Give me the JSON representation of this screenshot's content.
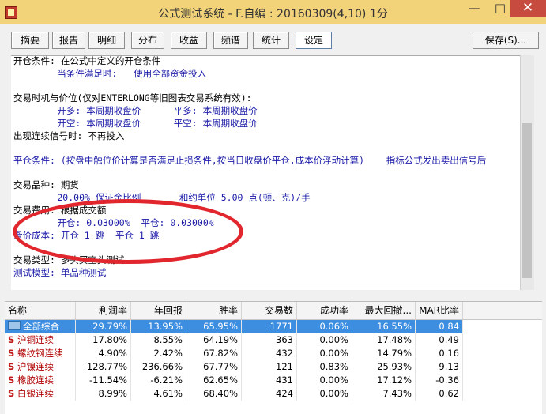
{
  "window": {
    "title": "公式测试系统 - F.自编 : 20160309(4,10) 1分",
    "minimize": "—",
    "maximize": "□",
    "close": "✕"
  },
  "tabs": [
    "摘要",
    "报告",
    "明细",
    "分布",
    "收益",
    "频谱",
    "统计",
    "设定"
  ],
  "active_tab": "设定",
  "save_button": "保存(S)...",
  "report_lines": [
    {
      "text": "开仓条件: 在公式中定义的开仓条件",
      "color": "blk"
    },
    {
      "text": "        当条件满足时:   使用全部资金投入",
      "color": "blu"
    },
    {
      "text": "交易时机与价位(仅对ENTERLONG等旧图表交易系统有效):",
      "color": "blk"
    },
    {
      "text": "        开多: 本周期收盘价      平多: 本周期收盘价",
      "color": "blu"
    },
    {
      "text": "        开空: 本周期收盘价      平空: 本周期收盘价",
      "color": "blu"
    },
    {
      "text": "出现连续信号时: 不再投入",
      "color": "blk"
    },
    {
      "text": "平仓条件: (按盘中触位价计算是否满足止损条件,按当日收盘价平仓,成本价浮动计算)    指标公式发出卖出信号后",
      "color": "blu"
    },
    {
      "text": "交易品种: 期货",
      "color": "blk"
    },
    {
      "text": "        20.00% 保证金比例       和约单位 5.00 点(顿、克)/手",
      "color": "blu"
    },
    {
      "text": "交易费用: 根据成交额",
      "color": "blk"
    },
    {
      "text": "        开仓: 0.03000%  平仓: 0.03000%",
      "color": "blu"
    },
    {
      "text": "滑价成本: 开仓 1 跳  平仓 1 跳",
      "color": "blu"
    },
    {
      "text": "交易类型: 多头买空头测试",
      "color": "blk"
    },
    {
      "text": "测试模型: 单品种测试",
      "color": "blu"
    }
  ],
  "table": {
    "columns": [
      "名称",
      "利润率",
      "年回报",
      "胜率",
      "交易数",
      "成功率",
      "最大回撤...",
      "MAR比率"
    ],
    "rows": [
      {
        "icon": "folder",
        "cells": [
          "全部综合",
          "29.79%",
          "13.95%",
          "65.95%",
          "1771",
          "0.06%",
          "16.55%",
          "0.84"
        ]
      },
      {
        "icon": "S",
        "cells": [
          "沪铜连续",
          "17.80%",
          "8.55%",
          "64.19%",
          "363",
          "0.00%",
          "17.48%",
          "0.49"
        ]
      },
      {
        "icon": "S",
        "cells": [
          "螺纹钢连续",
          "4.90%",
          "2.42%",
          "67.82%",
          "432",
          "0.00%",
          "14.79%",
          "0.16"
        ]
      },
      {
        "icon": "S",
        "cells": [
          "沪镍连续",
          "128.77%",
          "236.66%",
          "67.77%",
          "121",
          "0.83%",
          "25.93%",
          "9.13"
        ]
      },
      {
        "icon": "S",
        "cells": [
          "橡胶连续",
          "-11.54%",
          "-6.21%",
          "62.65%",
          "431",
          "0.00%",
          "17.12%",
          "-0.36"
        ]
      },
      {
        "icon": "S",
        "cells": [
          "白银连续",
          "8.99%",
          "4.61%",
          "68.40%",
          "424",
          "0.00%",
          "7.43%",
          "0.62"
        ]
      }
    ]
  },
  "colors": {
    "titlebar": "#f3d37a",
    "selection": "#3d8ee0",
    "highlight_ring": "#e1262e",
    "stock_red": "#b00000"
  }
}
